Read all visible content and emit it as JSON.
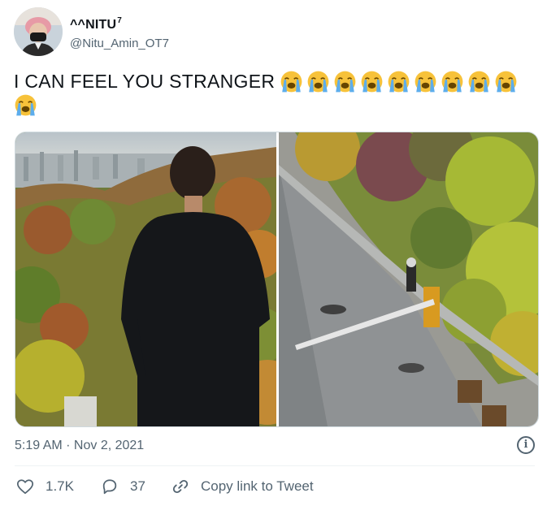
{
  "user": {
    "display_name": "^^NITU",
    "superscript": "7",
    "handle": "@Nitu_Amin_OT7"
  },
  "tweet": {
    "text": "I CAN FEEL YOU STRANGER",
    "emoji": "loudly-crying-face",
    "emoji_count": 10
  },
  "media": {
    "photos": [
      {
        "subject": "man in black shirt overlooking autumn mountain and city"
      },
      {
        "subject": "road with barrier gate seen from above, person near trees"
      }
    ]
  },
  "meta": {
    "timestamp": "5:19 AM · Nov 2, 2021",
    "info_icon": "info-icon"
  },
  "actions": {
    "likes": "1.7K",
    "replies": "37",
    "share_label": "Copy link to Tweet"
  },
  "colors": {
    "text": "#0f1419",
    "secondary": "#536471",
    "border": "#cfd9de"
  }
}
